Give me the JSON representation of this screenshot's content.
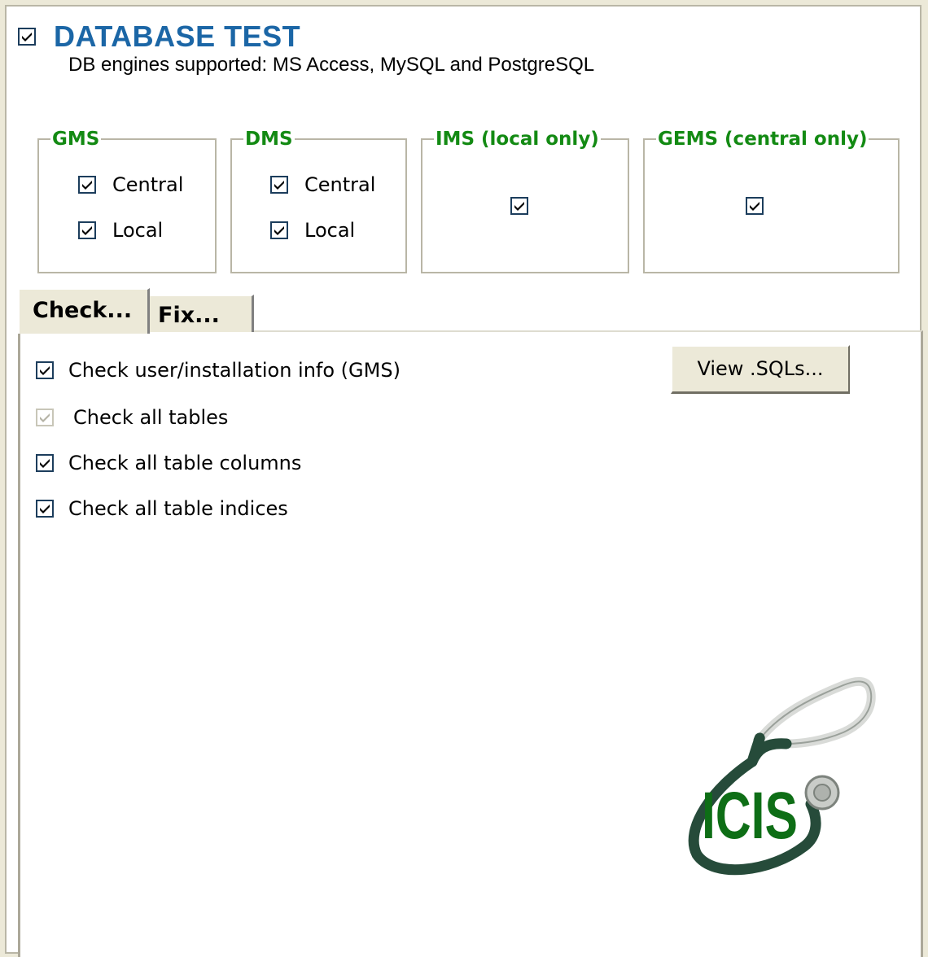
{
  "header": {
    "title": "DATABASE TEST",
    "checked": true,
    "subtitle": "DB engines supported: MS Access, MySQL and PostgreSQL"
  },
  "groups": [
    {
      "title": "GMS",
      "items": [
        {
          "label": "Central",
          "checked": true
        },
        {
          "label": "Local",
          "checked": true
        }
      ]
    },
    {
      "title": "DMS",
      "items": [
        {
          "label": "Central",
          "checked": true
        },
        {
          "label": "Local",
          "checked": true
        }
      ]
    },
    {
      "title": "IMS (local only)",
      "items": [
        {
          "label": "",
          "checked": true
        }
      ]
    },
    {
      "title": "GEMS (central only)",
      "items": [
        {
          "label": "",
          "checked": true
        }
      ]
    }
  ],
  "tabs": [
    {
      "label": "Check...",
      "active": true
    },
    {
      "label": "Fix...",
      "active": false
    }
  ],
  "check_panel": {
    "view_sqls_button": "View .SQLs...",
    "options": [
      {
        "label": "Check user/installation info (GMS)",
        "checked": true,
        "disabled": false
      },
      {
        "label": "Check all tables",
        "checked": true,
        "disabled": true
      },
      {
        "label": "Check all table columns",
        "checked": true,
        "disabled": false
      },
      {
        "label": "Check all table indices",
        "checked": true,
        "disabled": false
      }
    ]
  },
  "logo": {
    "text": "ICIS",
    "icon": "stethoscope-icon"
  },
  "colors": {
    "title_blue": "#1b66a6",
    "group_green": "#138a13",
    "logo_green": "#0e6e16",
    "stethoscope": "#264b3a"
  }
}
